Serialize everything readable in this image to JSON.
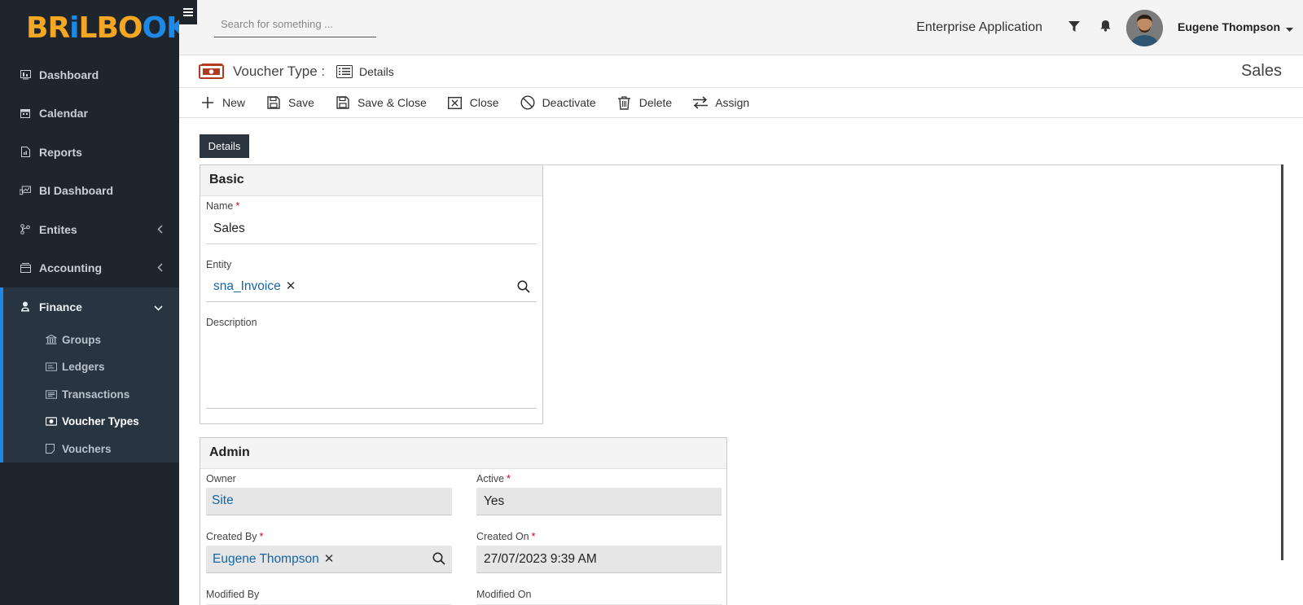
{
  "brand": {
    "logo_text": "BRiLBOOK",
    "logo_parts": [
      "BR",
      "i",
      "LBO",
      "OK"
    ],
    "colors": {
      "orange": "#f5a623",
      "blue": "#1e88e5"
    }
  },
  "topbar": {
    "search_placeholder": "Search for something ...",
    "app_name": "Enterprise Application",
    "user_name": "Eugene Thompson"
  },
  "sidebar": {
    "items": [
      {
        "label": "Dashboard",
        "icon": "dashboard-icon"
      },
      {
        "label": "Calendar",
        "icon": "calendar-icon"
      },
      {
        "label": "Reports",
        "icon": "report-icon"
      },
      {
        "label": "BI Dashboard",
        "icon": "bi-dashboard-icon"
      },
      {
        "label": "Entites",
        "icon": "entities-icon",
        "expandable": true
      },
      {
        "label": "Accounting",
        "icon": "accounting-icon",
        "expandable": true
      }
    ],
    "finance": {
      "label": "Finance",
      "icon": "finance-icon",
      "expanded": true,
      "children": [
        {
          "label": "Groups",
          "icon": "bank-icon"
        },
        {
          "label": "Ledgers",
          "icon": "ledger-icon"
        },
        {
          "label": "Transactions",
          "icon": "transactions-icon"
        },
        {
          "label": "Voucher Types",
          "icon": "voucher-type-icon",
          "active": true
        },
        {
          "label": "Vouchers",
          "icon": "voucher-icon"
        }
      ]
    }
  },
  "titlebar": {
    "entity": "Voucher Type :",
    "view": "Details",
    "record": "Sales"
  },
  "toolbar": {
    "buttons": [
      {
        "label": "New",
        "icon": "plus-icon"
      },
      {
        "label": "Save",
        "icon": "save-icon"
      },
      {
        "label": "Save & Close",
        "icon": "save-close-icon"
      },
      {
        "label": "Close",
        "icon": "close-box-icon"
      },
      {
        "label": "Deactivate",
        "icon": "deactivate-icon"
      },
      {
        "label": "Delete",
        "icon": "trash-icon"
      },
      {
        "label": "Assign",
        "icon": "assign-icon"
      }
    ]
  },
  "tabs": {
    "details": "Details"
  },
  "basic": {
    "title": "Basic",
    "name_label": "Name",
    "name_value": "Sales",
    "entity_label": "Entity",
    "entity_value": "sna_Invoice",
    "description_label": "Description",
    "description_value": ""
  },
  "admin": {
    "title": "Admin",
    "owner_label": "Owner",
    "owner_value": "Site",
    "active_label": "Active",
    "active_value": "Yes",
    "created_by_label": "Created By",
    "created_by_value": "Eugene Thompson",
    "created_on_label": "Created On",
    "created_on_value": "27/07/2023 9:39 AM",
    "modified_by_label": "Modified By",
    "modified_on_label": "Modified On"
  },
  "required_marker": "*"
}
